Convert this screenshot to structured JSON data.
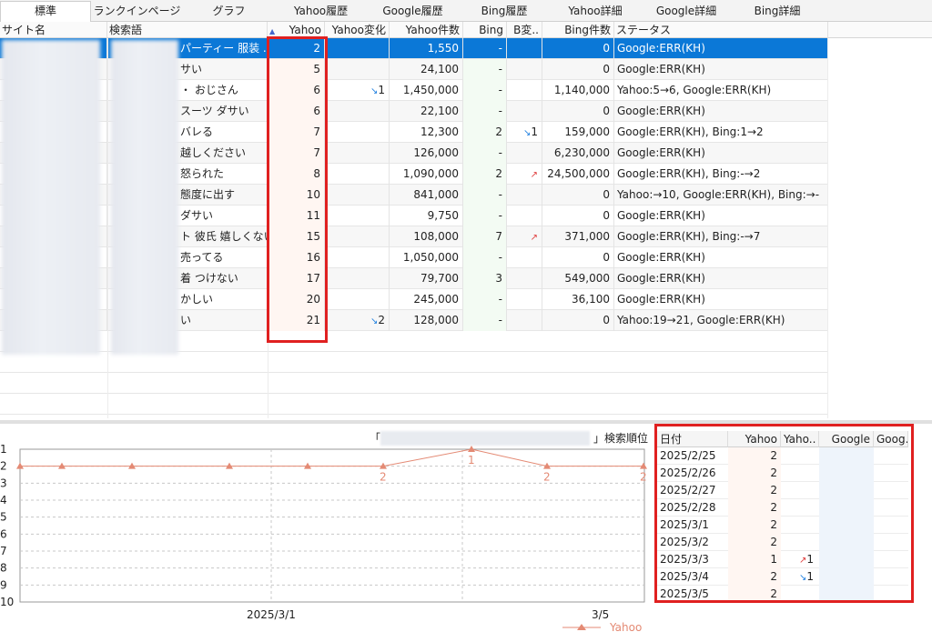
{
  "tabs": [
    "標準",
    "ランクインページ",
    "グラフ",
    "Yahoo履歴",
    "Google履歴",
    "Bing履歴",
    "Yahoo詳細",
    "Google詳細",
    "Bing詳細"
  ],
  "columns": {
    "site": "サイト名",
    "keyword": "検索語",
    "yahoo": "Yahoo",
    "yahoo_change": "Yahoo変化",
    "yahoo_count": "Yahoo件数",
    "bing": "Bing",
    "bing_change": "B変..",
    "bing_count": "Bing件数",
    "status": "ステータス"
  },
  "rows": [
    {
      "kw": "パーティー 服装 ..",
      "yahoo": "2",
      "ychg": "",
      "ycnt": "1,550",
      "bing": "-",
      "bchg": "",
      "bcnt": "0",
      "status": "Google:ERR(KH)"
    },
    {
      "kw": "サい",
      "yahoo": "5",
      "ychg": "",
      "ycnt": "24,100",
      "bing": "-",
      "bchg": "",
      "bcnt": "0",
      "status": "Google:ERR(KH)"
    },
    {
      "kw": "・ おじさん",
      "yahoo": "6",
      "ychg": "↘1",
      "ycnt": "1,450,000",
      "bing": "-",
      "bchg": "",
      "bcnt": "1,140,000",
      "status": "Yahoo:5→6, Google:ERR(KH)"
    },
    {
      "kw": "スーツ ダサい",
      "yahoo": "6",
      "ychg": "",
      "ycnt": "22,100",
      "bing": "-",
      "bchg": "",
      "bcnt": "0",
      "status": "Google:ERR(KH)"
    },
    {
      "kw": "バレる",
      "yahoo": "7",
      "ychg": "",
      "ycnt": "12,300",
      "bing": "2",
      "bchg": "↘1",
      "bcnt": "159,000",
      "status": "Google:ERR(KH), Bing:1→2"
    },
    {
      "kw": "越しください",
      "yahoo": "7",
      "ychg": "",
      "ycnt": "126,000",
      "bing": "-",
      "bchg": "",
      "bcnt": "6,230,000",
      "status": "Google:ERR(KH)"
    },
    {
      "kw": "怒られた",
      "yahoo": "8",
      "ychg": "",
      "ycnt": "1,090,000",
      "bing": "2",
      "bchg": "↗",
      "bcnt": "24,500,000",
      "status": "Google:ERR(KH), Bing:-→2"
    },
    {
      "kw": "態度に出す",
      "yahoo": "10",
      "ychg": "",
      "ycnt": "841,000",
      "bing": "-",
      "bchg": "",
      "bcnt": "0",
      "status": "Yahoo:→10, Google:ERR(KH), Bing:→-"
    },
    {
      "kw": "ダサい",
      "yahoo": "11",
      "ychg": "",
      "ycnt": "9,750",
      "bing": "-",
      "bchg": "",
      "bcnt": "0",
      "status": "Google:ERR(KH)"
    },
    {
      "kw": "ト 彼氏 嬉しくない",
      "yahoo": "15",
      "ychg": "",
      "ycnt": "108,000",
      "bing": "7",
      "bchg": "↗",
      "bcnt": "371,000",
      "status": "Google:ERR(KH), Bing:-→7"
    },
    {
      "kw": "売ってる",
      "yahoo": "16",
      "ychg": "",
      "ycnt": "1,050,000",
      "bing": "-",
      "bchg": "",
      "bcnt": "0",
      "status": "Google:ERR(KH)"
    },
    {
      "kw": "着 つけない",
      "yahoo": "17",
      "ychg": "",
      "ycnt": "79,700",
      "bing": "3",
      "bchg": "",
      "bcnt": "549,000",
      "status": "Google:ERR(KH)"
    },
    {
      "kw": "かしい",
      "yahoo": "20",
      "ychg": "",
      "ycnt": "245,000",
      "bing": "-",
      "bchg": "",
      "bcnt": "36,100",
      "status": "Google:ERR(KH)"
    },
    {
      "kw": "い",
      "yahoo": "21",
      "ychg": "↘2",
      "ycnt": "128,000",
      "bing": "-",
      "bchg": "",
      "bcnt": "0",
      "status": "Yahoo:19→21, Google:ERR(KH)"
    }
  ],
  "chart": {
    "title_open": "「",
    "title_close": "」検索順位",
    "legend": "Yahoo",
    "x_labels": [
      "2025/3/1",
      "3/5"
    ]
  },
  "chart_data": {
    "type": "line",
    "title": "「」検索順位",
    "ylim": [
      1,
      10
    ],
    "y_reversed": true,
    "y_ticks": [
      1,
      2,
      3,
      4,
      5,
      6,
      7,
      8,
      9,
      10
    ],
    "x_labels": [
      "2025/3/1",
      "3/5"
    ],
    "series": [
      {
        "name": "Yahoo",
        "color": "#e48a74",
        "values": [
          2,
          2,
          2,
          2,
          2,
          2,
          1,
          2,
          2
        ],
        "labels": [
          "",
          "",
          "",
          "",
          "",
          "2",
          "1",
          "2",
          "2"
        ]
      }
    ]
  },
  "detail": {
    "headers": {
      "date": "日付",
      "yahoo": "Yahoo",
      "yahoo_change": "Yaho..",
      "google": "Google",
      "google_change": "Goog.."
    },
    "rows": [
      {
        "date": "2025/2/25",
        "yahoo": "2",
        "chg": ""
      },
      {
        "date": "2025/2/26",
        "yahoo": "2",
        "chg": ""
      },
      {
        "date": "2025/2/27",
        "yahoo": "2",
        "chg": ""
      },
      {
        "date": "2025/2/28",
        "yahoo": "2",
        "chg": ""
      },
      {
        "date": "2025/3/1",
        "yahoo": "2",
        "chg": ""
      },
      {
        "date": "2025/3/2",
        "yahoo": "2",
        "chg": ""
      },
      {
        "date": "2025/3/3",
        "yahoo": "1",
        "chg": "↗1"
      },
      {
        "date": "2025/3/4",
        "yahoo": "2",
        "chg": "↘1"
      },
      {
        "date": "2025/3/5",
        "yahoo": "2",
        "chg": ""
      }
    ]
  },
  "colors": {
    "selection": "#0b78d7",
    "highlight_box": "#e02020",
    "line": "#e48a74",
    "up": "#e04040",
    "down": "#2080e0"
  }
}
